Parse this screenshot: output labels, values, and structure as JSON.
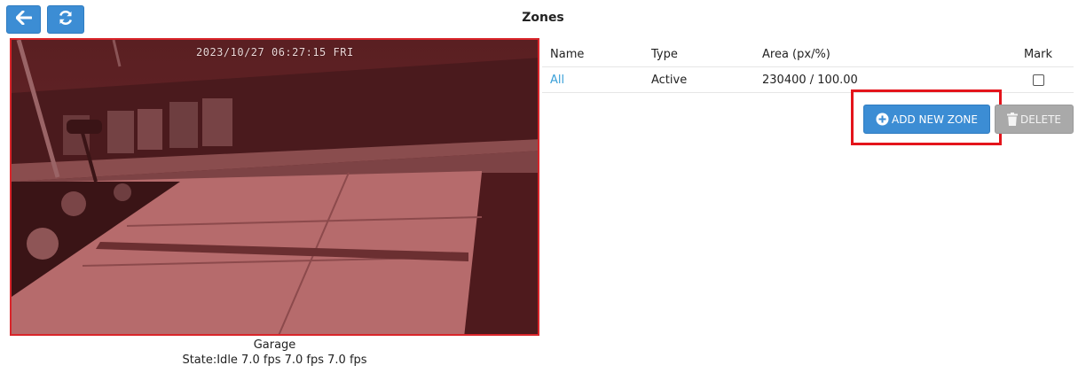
{
  "header": {
    "title": "Zones",
    "back_icon": "arrow-left-icon",
    "refresh_icon": "refresh-icon",
    "accent_color": "#3c8dd4"
  },
  "camera": {
    "timestamp": "2023/10/27 06:27:15 FRI",
    "name": "Garage",
    "state": "State:Idle 7.0 fps 7.0 fps 7.0 fps",
    "frame_border_color": "#d9252a"
  },
  "zones_table": {
    "headers": {
      "name": "Name",
      "type": "Type",
      "area": "Area (px/%)",
      "mark": "Mark"
    },
    "rows": [
      {
        "name": "All",
        "type": "Active",
        "area": "230400 / 100.00",
        "marked": false
      }
    ]
  },
  "actions": {
    "add_label": "ADD NEW ZONE",
    "add_icon": "plus-circle-icon",
    "delete_label": "DELETE",
    "delete_icon": "trash-icon",
    "delete_color": "#a9a9a9",
    "highlight_color": "#e4141b"
  }
}
